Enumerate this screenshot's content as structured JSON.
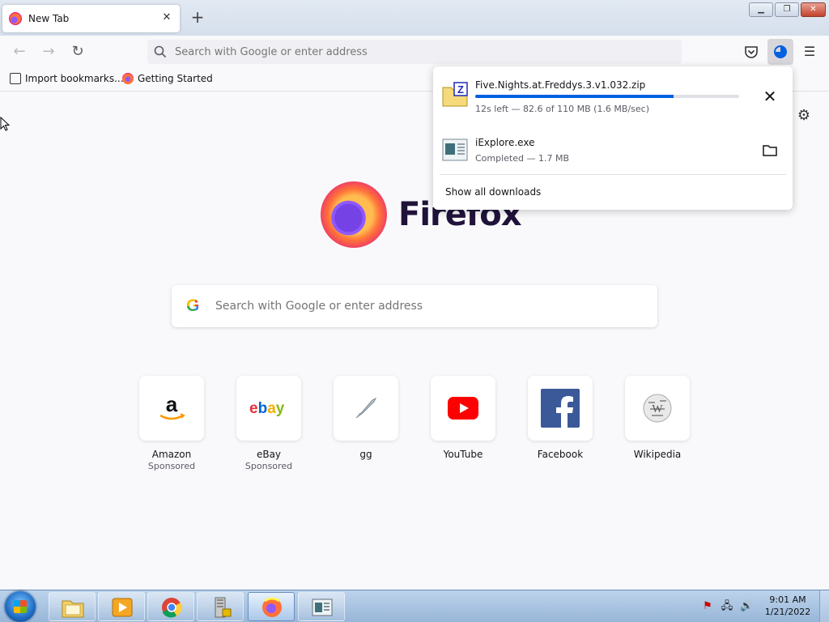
{
  "tab": {
    "title": "New Tab"
  },
  "urlbar": {
    "placeholder": "Search with Google or enter address"
  },
  "bookmarks": [
    {
      "label": "Import bookmarks..."
    },
    {
      "label": "Getting Started"
    }
  ],
  "newtab": {
    "brand": "Firefox",
    "search_placeholder": "Search with Google or enter address",
    "tiles": [
      {
        "label": "Amazon",
        "sub": "Sponsored",
        "icon": "amazon-icon"
      },
      {
        "label": "eBay",
        "sub": "Sponsored",
        "icon": "ebay-icon"
      },
      {
        "label": "gg",
        "sub": "",
        "icon": "gg-icon"
      },
      {
        "label": "YouTube",
        "sub": "",
        "icon": "youtube-icon"
      },
      {
        "label": "Facebook",
        "sub": "",
        "icon": "facebook-icon"
      },
      {
        "label": "Wikipedia",
        "sub": "",
        "icon": "wikipedia-icon"
      }
    ]
  },
  "downloads": {
    "items": [
      {
        "name": "Five.Nights.at.Freddys.3.v1.032.zip",
        "status": "12s left — 82.6 of 110 MB (1.6 MB/sec)",
        "progress": 0.75,
        "icon": "zip-file-icon"
      },
      {
        "name": "iExplore.exe",
        "status": "Completed — 1.7 MB",
        "icon": "exe-file-icon"
      }
    ],
    "show_all": "Show all downloads"
  },
  "clock": {
    "time": "9:01 AM",
    "date": "1/21/2022"
  },
  "colors": {
    "accent": "#0060df",
    "firefox_dark": "#20123a",
    "youtube_red": "#ff0000",
    "facebook_blue": "#3b5998"
  }
}
